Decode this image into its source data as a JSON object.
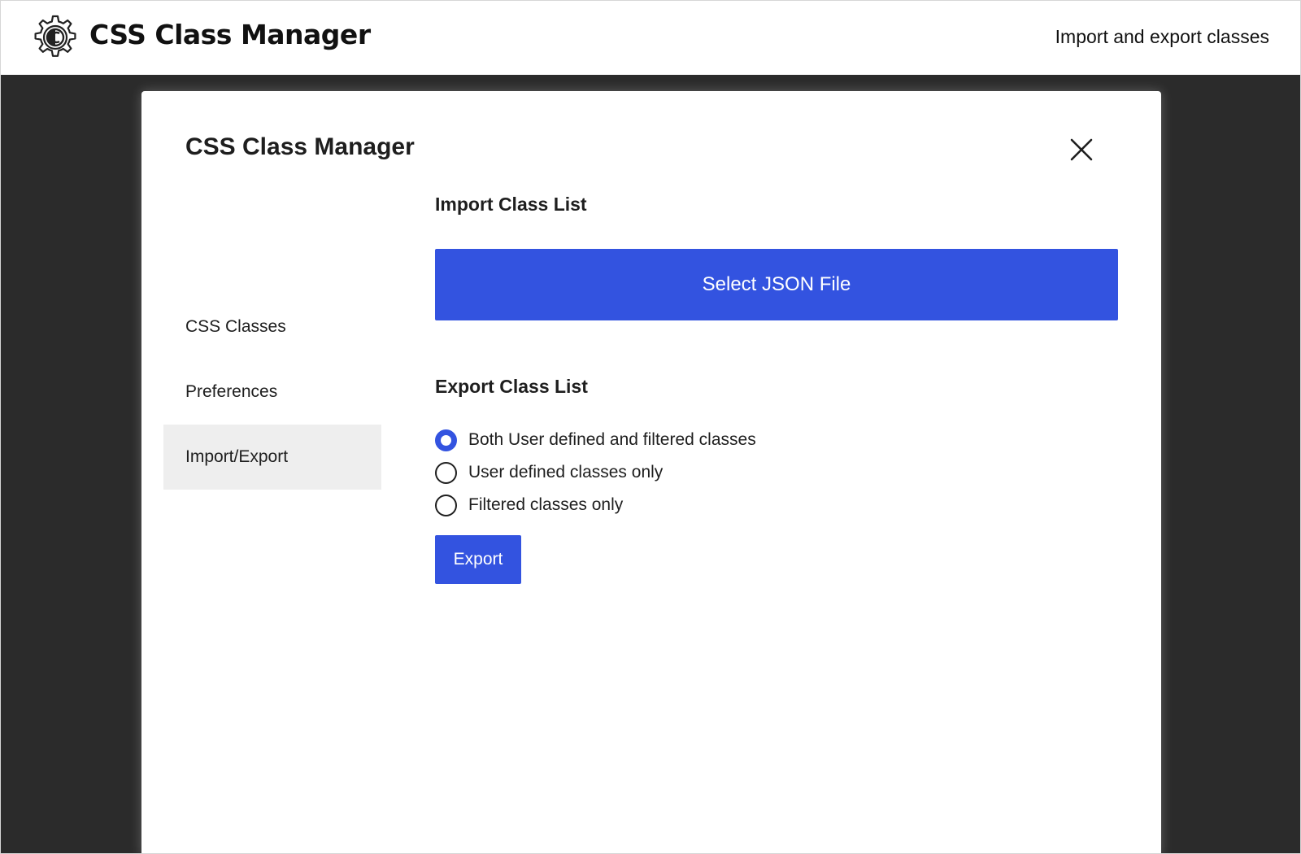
{
  "header": {
    "title": "CSS Class Manager",
    "subtitle": "Import and export classes",
    "logo_icon": "gear-c-logo-icon"
  },
  "modal": {
    "title": "CSS Class Manager",
    "close_icon": "close-icon",
    "nav": {
      "items": [
        {
          "label": "CSS Classes",
          "active": false
        },
        {
          "label": "Preferences",
          "active": false
        },
        {
          "label": "Import/Export",
          "active": true
        }
      ]
    },
    "import": {
      "heading": "Import Class List",
      "select_label": "Select JSON File"
    },
    "export": {
      "heading": "Export Class List",
      "options": [
        {
          "label": "Both User defined and filtered classes",
          "checked": true
        },
        {
          "label": "User defined classes only",
          "checked": false
        },
        {
          "label": "Filtered classes only",
          "checked": false
        }
      ],
      "export_label": "Export"
    }
  },
  "colors": {
    "accent": "#3353e0",
    "backdrop": "#2b2b2b",
    "nav_active_bg": "#eeeeee"
  }
}
